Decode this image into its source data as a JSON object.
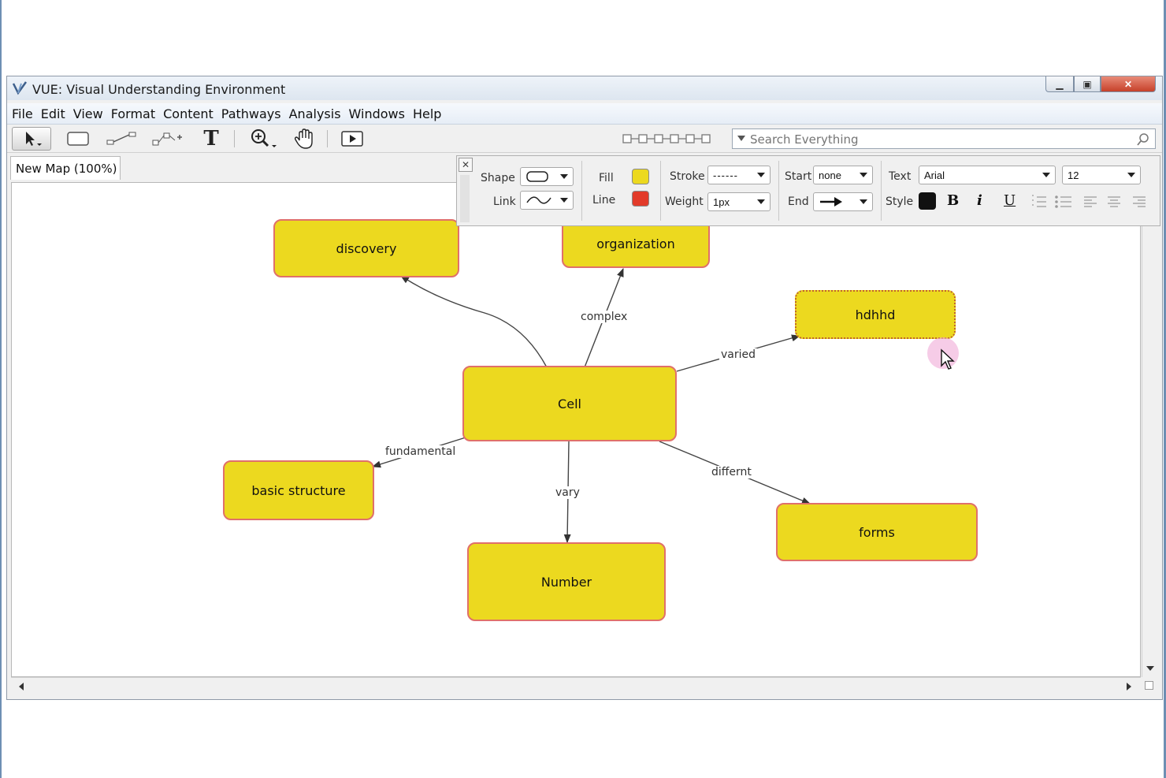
{
  "window": {
    "title": "VUE: Visual Understanding Environment"
  },
  "menu": [
    "File",
    "Edit",
    "View",
    "Format",
    "Content",
    "Pathways",
    "Analysis",
    "Windows",
    "Help"
  ],
  "search": {
    "placeholder": "Search Everything"
  },
  "map_tab": {
    "label": "New Map (100%)"
  },
  "format_panel": {
    "shape_label": "Shape",
    "link_label": "Link",
    "fill_label": "Fill",
    "line_label": "Line",
    "fill_color": "#ecd91f",
    "line_color": "#e23b2a",
    "stroke_label": "Stroke",
    "stroke_value": "------",
    "weight_label": "Weight",
    "weight_value": "1px",
    "start_label": "Start",
    "start_value": "none",
    "end_label": "End",
    "text_label": "Text",
    "font_value": "Arial",
    "size_value": "12",
    "style_label": "Style",
    "bold": "B",
    "italic": "i",
    "underline": "U"
  },
  "nodes": {
    "discovery": "discovery",
    "organization": "organization",
    "hdhhd": "hdhhd",
    "cell": "Cell",
    "basic_structure": "basic structure",
    "number": "Number",
    "forms": "forms"
  },
  "links": {
    "complex": "complex",
    "varied": "varied",
    "fundamental": "fundamental",
    "vary": "vary",
    "differnt": "differnt"
  },
  "colors": {
    "node_fill": "#ecd91f",
    "node_border": "#e0706a"
  }
}
